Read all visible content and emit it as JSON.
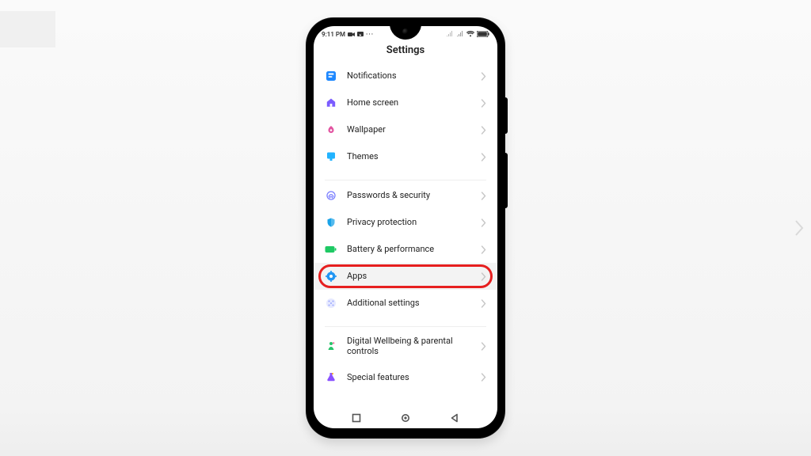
{
  "status": {
    "time": "9:11 PM",
    "indicator_dots_label": "…"
  },
  "title": "Settings",
  "rows": [
    {
      "id": "notifications",
      "label": "Notifications",
      "icon": "notifications-icon",
      "color": "#1e88ff"
    },
    {
      "id": "home-screen",
      "label": "Home screen",
      "icon": "home-icon",
      "color": "#7b5cff"
    },
    {
      "id": "wallpaper",
      "label": "Wallpaper",
      "icon": "wallpaper-icon",
      "color": "#e253a0"
    },
    {
      "id": "themes",
      "label": "Themes",
      "icon": "themes-icon",
      "color": "#22b3ff"
    },
    {
      "divider": true
    },
    {
      "id": "passwords-security",
      "label": "Passwords & security",
      "icon": "fingerprint-icon",
      "color": "#7a7fff"
    },
    {
      "id": "privacy",
      "label": "Privacy protection",
      "icon": "shield-icon",
      "color": "#1aa3e8"
    },
    {
      "id": "battery",
      "label": "Battery & performance",
      "icon": "battery-icon",
      "color": "#1ec964"
    },
    {
      "id": "apps",
      "label": "Apps",
      "icon": "gear-icon",
      "color": "#2196f3",
      "highlight": true,
      "callout": true
    },
    {
      "id": "additional",
      "label": "Additional settings",
      "icon": "dots-grid-icon",
      "color": "#9aa7ff"
    },
    {
      "divider": true
    },
    {
      "id": "wellbeing",
      "label": "Digital Wellbeing & parental controls",
      "icon": "wellbeing-icon",
      "color": "#27c36a"
    },
    {
      "id": "special",
      "label": "Special features",
      "icon": "flask-icon",
      "color": "#8a52ff"
    }
  ],
  "nav": {
    "recent": "■",
    "home": "●",
    "back": "◀"
  },
  "colors": {
    "accent": "#2196f3",
    "callout": "#e61f1f"
  }
}
